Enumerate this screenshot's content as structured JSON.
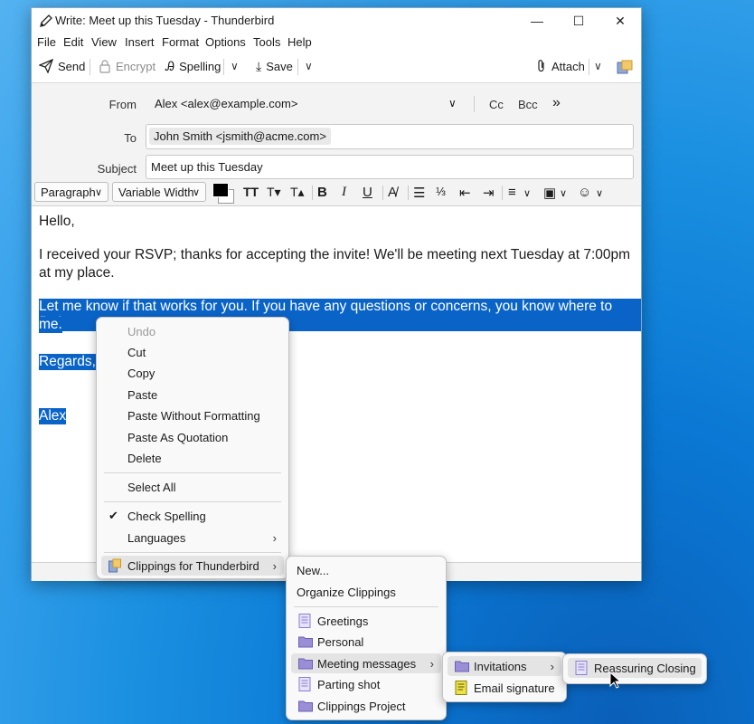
{
  "window": {
    "title": "Write: Meet up this Tuesday - Thunderbird",
    "controls": {
      "minimize": "—",
      "maximize": "☐",
      "close": "✕"
    }
  },
  "menubar": [
    "File",
    "Edit",
    "View",
    "Insert",
    "Format",
    "Options",
    "Tools",
    "Help"
  ],
  "toolbar": {
    "send": "Send",
    "encrypt": "Encrypt",
    "spelling": "Spelling",
    "save": "Save",
    "attach": "Attach"
  },
  "header": {
    "from_label": "From",
    "from_value": "Alex <alex@example.com>",
    "cc": "Cc",
    "bcc": "Bcc",
    "more": "»",
    "to_label": "To",
    "to_recipient": "John Smith <jsmith@acme.com>",
    "subject_label": "Subject",
    "subject_value": "Meet up this Tuesday"
  },
  "format": {
    "paragraph": "Paragraph",
    "font": "Variable Width",
    "text_color": "#000000"
  },
  "body": {
    "greeting": "Hello,",
    "para1_line1": "I received your RSVP; thanks for accepting the invite!  We'll be meeting next Tuesday at 7:00pm",
    "para1_line2": "at my place.",
    "sel_line1": "Let me know if that works for you. If you have any questions or concerns, you know where to find",
    "sel_line2": "me.",
    "regards": "Regards,",
    "signature": "Alex"
  },
  "context_menu": {
    "undo": "Undo",
    "cut": "Cut",
    "copy": "Copy",
    "paste": "Paste",
    "paste_plain": "Paste Without Formatting",
    "paste_quote": "Paste As Quotation",
    "delete": "Delete",
    "select_all": "Select All",
    "check_spelling": "Check Spelling",
    "languages": "Languages",
    "clippings": "Clippings for Thunderbird"
  },
  "clippings_menu": {
    "new": "New...",
    "organize": "Organize Clippings",
    "greetings": "Greetings",
    "personal": "Personal",
    "meeting": "Meeting messages",
    "parting": "Parting shot",
    "project": "Clippings Project"
  },
  "meeting_menu": {
    "invitations": "Invitations",
    "signature": "Email signature"
  },
  "invitations_menu": {
    "reassuring": "Reassuring Closing"
  },
  "colors": {
    "selection": "#0a64c8",
    "folder": "#9a8fd6",
    "clipping_doc": "#8b7fd0",
    "signature_clip": "#e6d800"
  }
}
